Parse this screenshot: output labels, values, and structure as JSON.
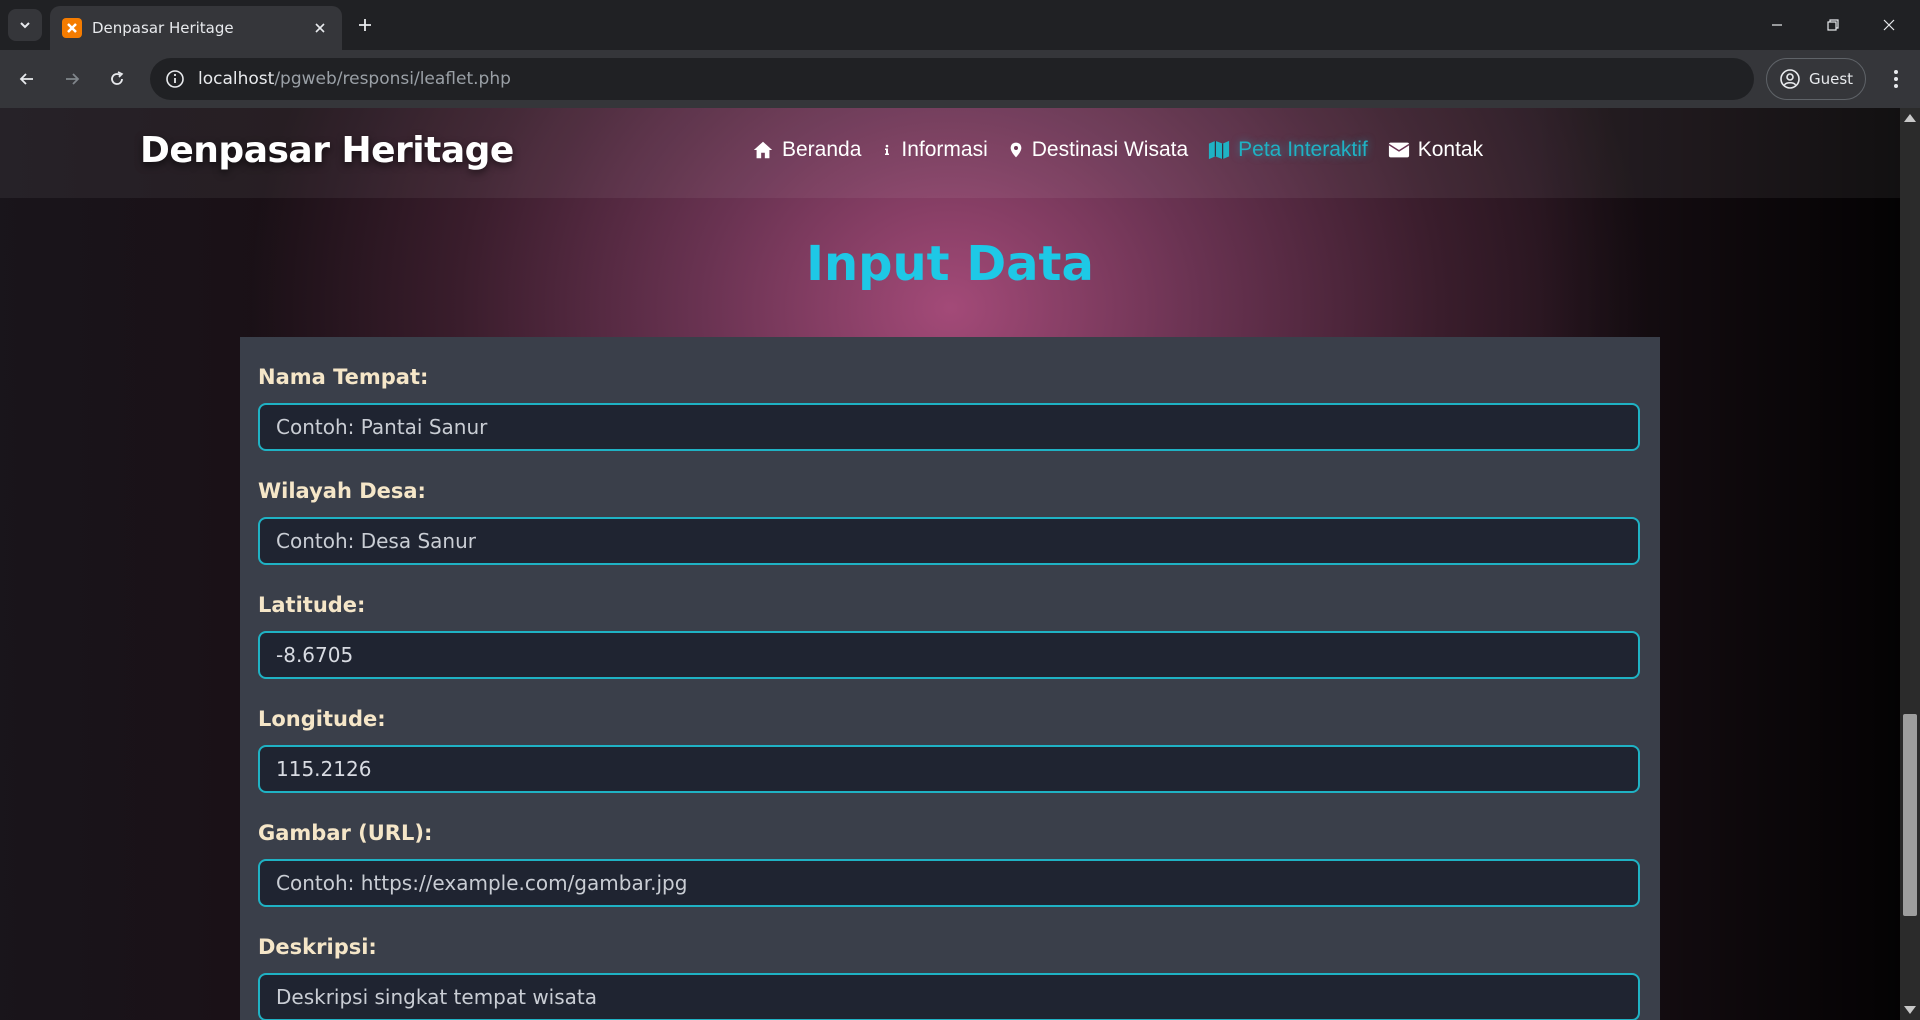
{
  "browser": {
    "tab_title": "Denpasar Heritage",
    "url_host": "localhost",
    "url_path": "/pgweb/responsi/leaflet.php",
    "profile_label": "Guest"
  },
  "site": {
    "brand": "Denpasar Heritage",
    "nav": [
      {
        "label": "Beranda",
        "icon": "home-icon"
      },
      {
        "label": "Informasi",
        "icon": "info-icon"
      },
      {
        "label": "Destinasi Wisata",
        "icon": "map-marker-icon"
      },
      {
        "label": "Peta Interaktif",
        "icon": "map-icon",
        "active": true
      },
      {
        "label": "Kontak",
        "icon": "envelope-icon"
      }
    ]
  },
  "form": {
    "title": "Input Data",
    "fields": [
      {
        "label": "Nama Tempat:",
        "placeholder": "Contoh: Pantai Sanur",
        "value": ""
      },
      {
        "label": "Wilayah Desa:",
        "placeholder": "Contoh: Desa Sanur",
        "value": ""
      },
      {
        "label": "Latitude:",
        "placeholder": "",
        "value": "-8.6705"
      },
      {
        "label": "Longitude:",
        "placeholder": "",
        "value": "115.2126"
      },
      {
        "label": "Gambar (URL):",
        "placeholder": "Contoh: https://example.com/gambar.jpg",
        "value": ""
      },
      {
        "label": "Deskripsi:",
        "placeholder": "Deskripsi singkat tempat wisata",
        "value": ""
      }
    ]
  },
  "colors": {
    "accent": "#1fb2c4",
    "title": "#1ec8e6",
    "label": "#f5e6c8",
    "panel": "#3a3f4a"
  }
}
